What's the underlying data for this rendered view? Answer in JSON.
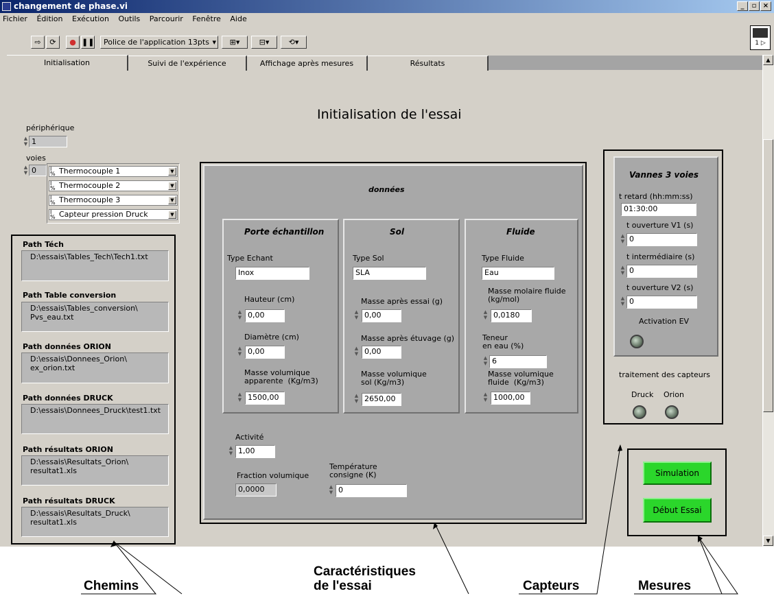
{
  "window": {
    "title": "changement de phase.vi"
  },
  "menu": [
    "Fichier",
    "Édition",
    "Exécution",
    "Outils",
    "Parcourir",
    "Fenêtre",
    "Aide"
  ],
  "toolbar": {
    "font_label": "Police de l'application 13pts"
  },
  "tabs": [
    "Initialisation",
    "Suivi de l'expérience",
    "Affichage après mesures",
    "Résultats"
  ],
  "heading": "Initialisation de l'essai",
  "peripherique": {
    "label": "périphérique",
    "value": "1"
  },
  "voies": {
    "label": "voies",
    "value": "0",
    "items": [
      "Thermocouple 1",
      "Thermocouple 2",
      "Thermocouple 3",
      "Capteur pression Druck"
    ]
  },
  "paths": [
    {
      "label": "Path Téch",
      "value": "D:\\essais\\Tables_Tech\\Tech1.txt"
    },
    {
      "label": "Path Table conversion",
      "value": "D:\\essais\\Tables_conversion\\\nPvs_eau.txt"
    },
    {
      "label": "Path données  ORION",
      "value": "D:\\essais\\Donnees_Orion\\\nex_orion.txt"
    },
    {
      "label": "Path données DRUCK",
      "value": "D:\\essais\\Donnees_Druck\\test1.txt"
    },
    {
      "label": "Path résultats ORION",
      "value": "D:\\essais\\Resultats_Orion\\\nresultat1.xls"
    },
    {
      "label": "Path résultats DRUCK",
      "value": "D:\\essais\\Resultats_Druck\\\nresultat1.xls"
    }
  ],
  "donnees": {
    "title": "données",
    "porte": {
      "title": "Porte échantillon",
      "type_label": "Type Echant",
      "type_value": "Inox",
      "hauteur_label": "Hauteur (cm)",
      "hauteur_value": "0,00",
      "diametre_label": "Diamètre (cm)",
      "diametre_value": "0,00",
      "masse_label": "Masse volumique\napparente  (Kg/m3)",
      "masse_value": "1500,00"
    },
    "sol": {
      "title": "Sol",
      "type_label": "Type Sol",
      "type_value": "SLA",
      "essai_label": "Masse après essai (g)",
      "essai_value": "0,00",
      "etuvage_label": "Masse après étuvage (g)",
      "etuvage_value": "0,00",
      "masse_label": "Masse volumique\nsol (Kg/m3)",
      "masse_value": "2650,00"
    },
    "fluide": {
      "title": "Fluide",
      "type_label": "Type Fluide",
      "type_value": "Eau",
      "molaire_label": "Masse molaire fluide\n(kg/mol)",
      "molaire_value": "0,0180",
      "teneur_label": "Teneur\nen eau (%)",
      "teneur_value": "6",
      "masse_label": "Masse volumique\nfluide  (Kg/m3)",
      "masse_value": "1000,00"
    },
    "activite_label": "Activité",
    "activite_value": "1,00",
    "fraction_label": "Fraction volumique",
    "fraction_value": "0,0000",
    "temp_label": "Température\nconsigne (K)",
    "temp_value": "0"
  },
  "vannes": {
    "title": "Vannes 3 voies",
    "retard_label": "t retard (hh:mm:ss)",
    "retard_value": "01:30:00",
    "v1_label": "t ouverture V1 (s)",
    "v1_value": "0",
    "inter_label": "t intermédiaire (s)",
    "inter_value": "0",
    "v2_label": "t ouverture V2 (s)",
    "v2_value": "0",
    "ev_label": "Activation EV"
  },
  "capteurs": {
    "title": "traitement des capteurs",
    "druck": "Druck",
    "orion": "Orion"
  },
  "buttons": {
    "simulation": "Simulation",
    "debut": "Début Essai"
  },
  "annotations": {
    "chemins": "Chemins",
    "caract": "Caractéristiques\nde l'essai",
    "capteurs": "Capteurs",
    "mesures": "Mesures"
  }
}
